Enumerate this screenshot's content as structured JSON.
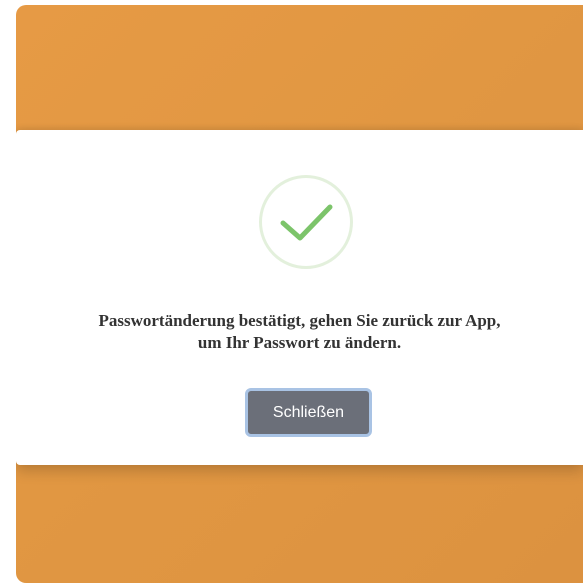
{
  "dialog": {
    "icon": "checkmark-icon",
    "message_line1": "Passwortänderung bestätigt, gehen Sie zurück zur App,",
    "message_line2": "um Ihr Passwort zu ändern.",
    "close_label": "Schließen"
  },
  "colors": {
    "background": "#e19742",
    "dialog": "#ffffff",
    "check": "#7cc46a",
    "check_ring": "#e3f0dc",
    "button": "#6b6f79",
    "button_border": "#a9c3e4"
  }
}
